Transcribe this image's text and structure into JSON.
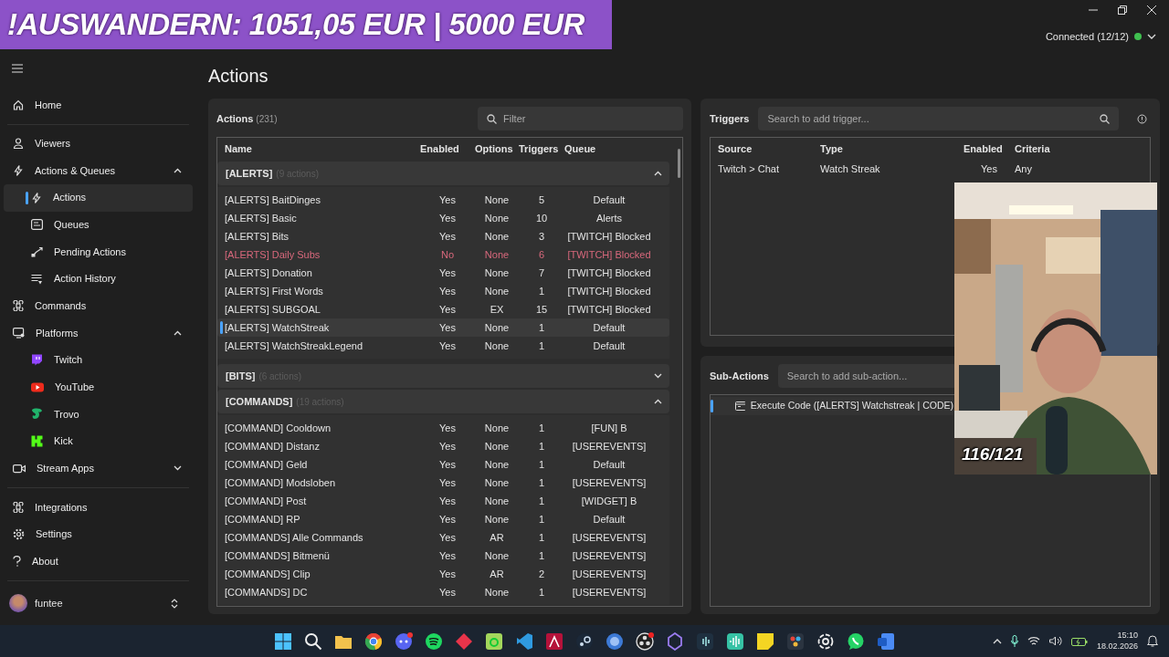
{
  "overlay_banner": {
    "text": "!AUSWANDERN: 1051,05 EUR | 5000 EUR"
  },
  "connection": {
    "label": "Connected (12/12)",
    "connected": true
  },
  "sidebar": {
    "sections": [
      [
        {
          "label": "Home",
          "selected": false
        }
      ],
      [
        {
          "label": "Viewers",
          "selected": false
        },
        {
          "label": "Actions & Queues",
          "selected": false,
          "expanded": true,
          "children": [
            {
              "label": "Actions",
              "selected": true
            },
            {
              "label": "Queues",
              "selected": false
            },
            {
              "label": "Pending Actions",
              "selected": false
            },
            {
              "label": "Action History",
              "selected": false
            }
          ]
        },
        {
          "label": "Commands",
          "selected": false
        },
        {
          "label": "Platforms",
          "selected": false,
          "expanded": true,
          "children": [
            {
              "label": "Twitch",
              "selected": false
            },
            {
              "label": "YouTube",
              "selected": false
            },
            {
              "label": "Trovo",
              "selected": false
            },
            {
              "label": "Kick",
              "selected": false
            }
          ]
        },
        {
          "label": "Stream Apps",
          "selected": false,
          "expanded": false
        }
      ],
      [
        {
          "label": "Integrations",
          "selected": false
        },
        {
          "label": "Settings",
          "selected": false
        },
        {
          "label": "About",
          "selected": false
        }
      ]
    ],
    "user": {
      "name": "funtee"
    }
  },
  "page": {
    "title": "Actions"
  },
  "actions": {
    "title": "Actions",
    "count": "(231)",
    "filter": {
      "placeholder": "Filter"
    },
    "columns": [
      "Name",
      "Enabled",
      "Options",
      "Triggers",
      "Queue"
    ],
    "groups": [
      {
        "name": "[ALERTS]",
        "count": "(9 actions)",
        "expanded": true,
        "rows": [
          {
            "name": "[ALERTS] BaitDinges",
            "enabled": "Yes",
            "options": "None",
            "triggers": "5",
            "queue": "Default",
            "disabled": false,
            "selected": false
          },
          {
            "name": "[ALERTS] Basic",
            "enabled": "Yes",
            "options": "None",
            "triggers": "10",
            "queue": "Alerts",
            "disabled": false,
            "selected": false
          },
          {
            "name": "[ALERTS] Bits",
            "enabled": "Yes",
            "options": "None",
            "triggers": "3",
            "queue": "[TWITCH] Blocked",
            "disabled": false,
            "selected": false
          },
          {
            "name": "[ALERTS] Daily Subs",
            "enabled": "No",
            "options": "None",
            "triggers": "6",
            "queue": "[TWITCH] Blocked",
            "disabled": true,
            "selected": false
          },
          {
            "name": "[ALERTS] Donation",
            "enabled": "Yes",
            "options": "None",
            "triggers": "7",
            "queue": "[TWITCH] Blocked",
            "disabled": false,
            "selected": false
          },
          {
            "name": "[ALERTS] First Words",
            "enabled": "Yes",
            "options": "None",
            "triggers": "1",
            "queue": "[TWITCH] Blocked",
            "disabled": false,
            "selected": false
          },
          {
            "name": "[ALERTS] SUBGOAL",
            "enabled": "Yes",
            "options": "EX",
            "triggers": "15",
            "queue": "[TWITCH] Blocked",
            "disabled": false,
            "selected": false
          },
          {
            "name": "[ALERTS] WatchStreak",
            "enabled": "Yes",
            "options": "None",
            "triggers": "1",
            "queue": "Default",
            "disabled": false,
            "selected": true
          },
          {
            "name": "[ALERTS] WatchStreakLegend",
            "enabled": "Yes",
            "options": "None",
            "triggers": "1",
            "queue": "Default",
            "disabled": false,
            "selected": false
          }
        ]
      },
      {
        "name": "[BITS]",
        "count": "(6 actions)",
        "expanded": false
      },
      {
        "name": "[COMMANDS]",
        "count": "(19 actions)",
        "expanded": true,
        "rows": [
          {
            "name": "[COMMAND] Cooldown",
            "enabled": "Yes",
            "options": "None",
            "triggers": "1",
            "queue": "[FUN] B",
            "disabled": false,
            "selected": false
          },
          {
            "name": "[COMMAND] Distanz",
            "enabled": "Yes",
            "options": "None",
            "triggers": "1",
            "queue": "[USEREVENTS]",
            "disabled": false,
            "selected": false
          },
          {
            "name": "[COMMAND] Geld",
            "enabled": "Yes",
            "options": "None",
            "triggers": "1",
            "queue": "Default",
            "disabled": false,
            "selected": false
          },
          {
            "name": "[COMMAND] Modsloben",
            "enabled": "Yes",
            "options": "None",
            "triggers": "1",
            "queue": "[USEREVENTS]",
            "disabled": false,
            "selected": false
          },
          {
            "name": "[COMMAND] Post",
            "enabled": "Yes",
            "options": "None",
            "triggers": "1",
            "queue": "[WIDGET] B",
            "disabled": false,
            "selected": false
          },
          {
            "name": "[COMMAND] RP",
            "enabled": "Yes",
            "options": "None",
            "triggers": "1",
            "queue": "Default",
            "disabled": false,
            "selected": false
          },
          {
            "name": "[COMMANDS] Alle Commands",
            "enabled": "Yes",
            "options": "AR",
            "triggers": "1",
            "queue": "[USEREVENTS]",
            "disabled": false,
            "selected": false
          },
          {
            "name": "[COMMANDS] Bitmenü",
            "enabled": "Yes",
            "options": "None",
            "triggers": "1",
            "queue": "[USEREVENTS]",
            "disabled": false,
            "selected": false
          },
          {
            "name": "[COMMANDS] Clip",
            "enabled": "Yes",
            "options": "AR",
            "triggers": "2",
            "queue": "[USEREVENTS]",
            "disabled": false,
            "selected": false
          },
          {
            "name": "[COMMANDS] DC",
            "enabled": "Yes",
            "options": "None",
            "triggers": "1",
            "queue": "[USEREVENTS]",
            "disabled": false,
            "selected": false
          }
        ]
      }
    ]
  },
  "triggers": {
    "title": "Triggers",
    "search": {
      "placeholder": "Search to add trigger..."
    },
    "columns": [
      "Source",
      "Type",
      "Enabled",
      "Criteria"
    ],
    "rows": [
      {
        "source": "Twitch > Chat",
        "type": "Watch Streak",
        "enabled": "Yes",
        "criteria": "Any"
      }
    ]
  },
  "sub_actions": {
    "title": "Sub-Actions",
    "search": {
      "placeholder": "Search to add sub-action..."
    },
    "items": [
      {
        "label": "Execute Code ([ALERTS] Watchstreak | CODE)",
        "selected": true
      }
    ]
  },
  "webcam": {
    "kind": "picture",
    "counter": "116/121"
  },
  "taskbar": {
    "time": "15:10",
    "date": "18.02.2026"
  }
}
